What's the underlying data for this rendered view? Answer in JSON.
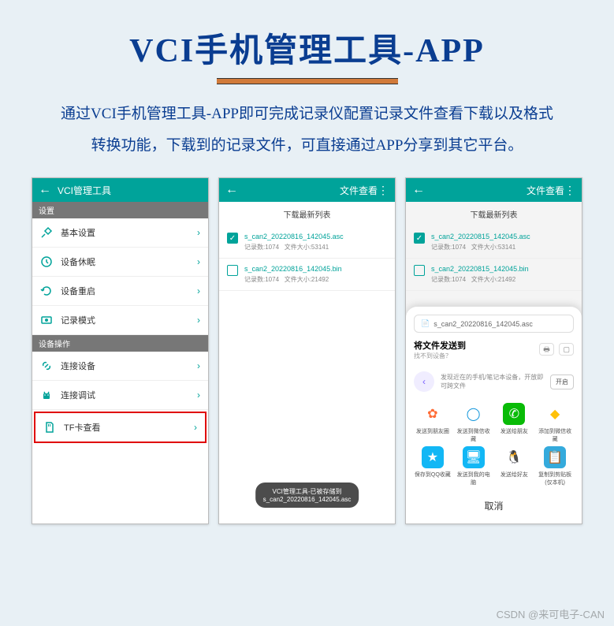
{
  "title": "VCI手机管理工具-APP",
  "description": "通过VCI手机管理工具-APP即可完成记录仪配置记录文件查看下载以及格式转换功能，下载到的记录文件，可直接通过APP分享到其它平台。",
  "watermark": "CSDN @来可电子-CAN",
  "phone1": {
    "title": "VCI管理工具",
    "section1": "设置",
    "items1": [
      {
        "label": "基本设置",
        "icon": "tools-icon"
      },
      {
        "label": "设备休眠",
        "icon": "clock-icon"
      },
      {
        "label": "设备重启",
        "icon": "refresh-icon"
      },
      {
        "label": "记录模式",
        "icon": "record-icon"
      }
    ],
    "section2": "设备操作",
    "items2": [
      {
        "label": "连接设备",
        "icon": "link-icon"
      },
      {
        "label": "连接调试",
        "icon": "android-icon"
      },
      {
        "label": "TF卡查看",
        "icon": "sdcard-icon",
        "highlight": true
      }
    ]
  },
  "phone2": {
    "title": "文件查看",
    "subheader": "下载最新列表",
    "files": [
      {
        "name": "s_can2_20220816_142045.asc",
        "records": "记录数:1074",
        "size": "文件大小:53141",
        "checked": true
      },
      {
        "name": "s_can2_20220816_142045.bin",
        "records": "记录数:1074",
        "size": "文件大小:21492",
        "checked": false
      }
    ],
    "toast_line1": "VCI管理工具-已被存储到",
    "toast_line2": "s_can2_20220816_142045.asc"
  },
  "phone3": {
    "title": "文件查看",
    "subheader": "下载最新列表",
    "files": [
      {
        "name": "s_can2_20220815_142045.asc",
        "records": "记录数:1074",
        "size": "文件大小:53141",
        "checked": true
      },
      {
        "name": "s_can2_20220815_142045.bin",
        "records": "记录数:1074",
        "size": "文件大小:21492",
        "checked": false
      }
    ],
    "sheet": {
      "filename": "s_can2_20220816_142045.asc",
      "prompt": "将文件发送到",
      "sub": "找不到设备？",
      "hint": "发现近在的手机/笔记本设备，开放即可跨文件",
      "open": "开启",
      "apps_row1": [
        {
          "label": "发送到朋友圈",
          "color": "#ff6b35"
        },
        {
          "label": "发送到微信收藏",
          "color": "#1296db"
        },
        {
          "label": "发送给朋友",
          "color": "#09bb07"
        },
        {
          "label": "添加到微信收藏",
          "color": "#ffc107"
        }
      ],
      "apps_row2": [
        {
          "label": "保存到QQ收藏",
          "color": "#12b7f5"
        },
        {
          "label": "发送到我的电脑",
          "color": "#12b7f5"
        },
        {
          "label": "发送给好友",
          "color": "#000"
        },
        {
          "label": "复制到剪贴板(仅本机)",
          "color": "#34aadc"
        }
      ],
      "cancel": "取消"
    }
  }
}
